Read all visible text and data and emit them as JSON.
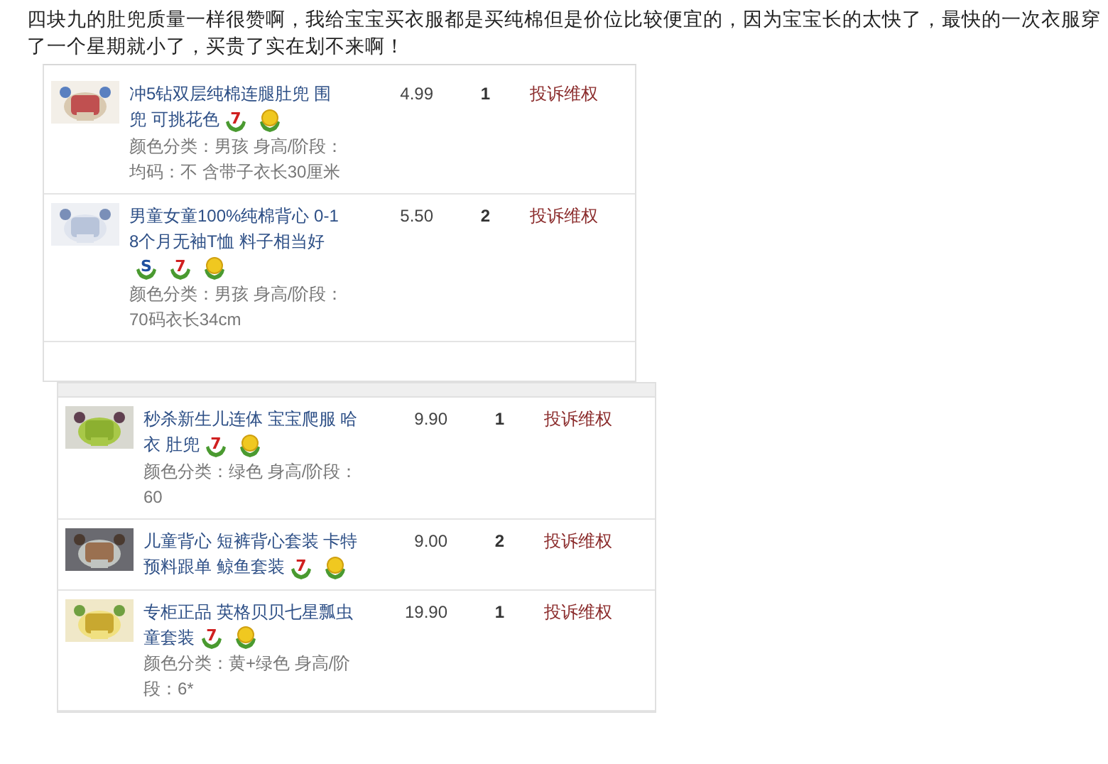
{
  "post": {
    "text": "四块九的肚兜质量一样很赞啊，我给宝宝买衣服都是买纯棉但是价位比较便宜的，因为宝宝长的太快了，最快的一次衣服穿了一个星期就小了，买贵了实在划不来啊！"
  },
  "orders": [
    {
      "items": [
        {
          "title": "冲5钻双层纯棉连腿肚兜 围兜 可挑花色",
          "badges": [
            {
              "kind": "mark",
              "glyph": "7"
            },
            {
              "kind": "coin"
            }
          ],
          "spec": "颜色分类：男孩 身高/阶段：均码：不 含带子衣长30厘米",
          "price": "4.99",
          "qty": "1",
          "action": "投诉维权"
        },
        {
          "title": "男童女童100%纯棉背心 0-18个月无袖T恤 料子相当好",
          "badges": [
            {
              "kind": "mark",
              "glyph": "S"
            },
            {
              "kind": "mark",
              "glyph": "7"
            },
            {
              "kind": "coin"
            }
          ],
          "spec": "颜色分类：男孩 身高/阶段：70码衣长34cm",
          "price": "5.50",
          "qty": "2",
          "action": "投诉维权"
        }
      ]
    },
    {
      "items": [
        {
          "title": "秒杀新生儿连体 宝宝爬服 哈衣 肚兜",
          "badges": [
            {
              "kind": "mark",
              "glyph": "7"
            },
            {
              "kind": "coin"
            }
          ],
          "spec": "颜色分类：绿色 身高/阶段：60",
          "price": "9.90",
          "qty": "1",
          "action": "投诉维权"
        },
        {
          "title": "儿童背心 短裤背心套装 卡特预料跟单 鲸鱼套装",
          "badges": [
            {
              "kind": "mark",
              "glyph": "7"
            },
            {
              "kind": "coin"
            }
          ],
          "price": "9.00",
          "qty": "2",
          "action": "投诉维权"
        },
        {
          "title": "专柜正品 英格贝贝七星瓢虫童套装",
          "badges": [
            {
              "kind": "mark",
              "glyph": "7"
            },
            {
              "kind": "coin"
            }
          ],
          "spec": "颜色分类：黄+绿色 身高/阶段：6*",
          "price": "19.90",
          "qty": "1",
          "action": "投诉维权"
        }
      ]
    }
  ]
}
